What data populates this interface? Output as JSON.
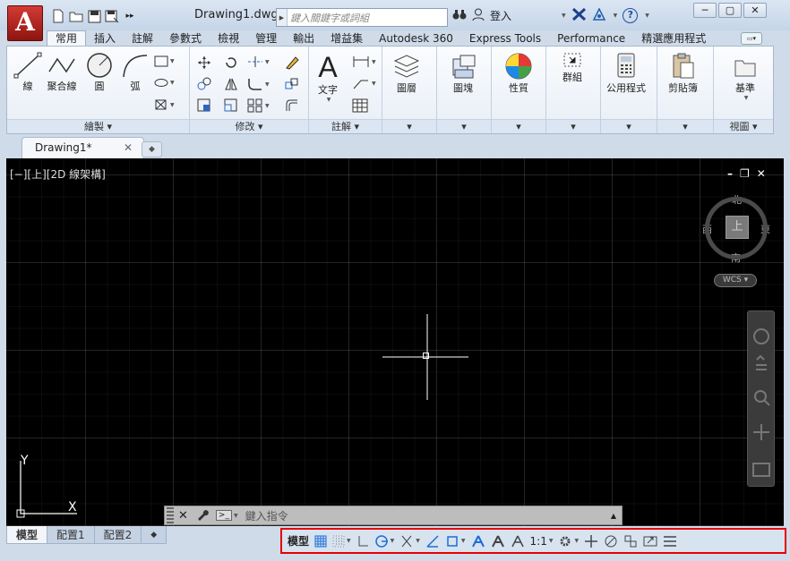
{
  "app": {
    "logo_letter": "A",
    "document_title": "Drawing1.dwg"
  },
  "search": {
    "placeholder": "鍵入關鍵字或詞組"
  },
  "title_tools": {
    "signin_label": "登入",
    "help_label": "?"
  },
  "window_controls": {
    "minimize": "─",
    "restore": "▢",
    "close": "✕"
  },
  "ribbon_tabs": [
    "常用",
    "插入",
    "註解",
    "參數式",
    "檢視",
    "管理",
    "輸出",
    "增益集",
    "Autodesk 360",
    "Express Tools",
    "Performance",
    "精選應用程式"
  ],
  "panels": {
    "draw": {
      "title": "繪製 ▾",
      "tools": [
        "線",
        "聚合線",
        "圓",
        "弧"
      ]
    },
    "modify": {
      "title": "修改 ▾"
    },
    "annotation": {
      "title": "註解 ▾",
      "text": "文字"
    },
    "layers": {
      "label": "圖層"
    },
    "block": {
      "label": "圖塊"
    },
    "properties": {
      "label": "性質"
    },
    "groups": {
      "label": "群組"
    },
    "utilities": {
      "label": "公用程式"
    },
    "clipboard": {
      "label": "剪貼簿"
    },
    "view": {
      "label": "基準",
      "title": "視圖 ▾"
    }
  },
  "doc_tab": {
    "label": "Drawing1*",
    "close": "✕"
  },
  "viewport": {
    "label": "[−][上][2D 線架構]",
    "controls": [
      "–",
      "❐",
      "✕"
    ]
  },
  "viewcube": {
    "top": "上",
    "north": "北",
    "south": "南",
    "east": "東",
    "west": "西",
    "wcs": "WCS"
  },
  "ucs": {
    "y": "Y",
    "x": "X"
  },
  "command": {
    "placeholder": "鍵入指令"
  },
  "layout_tabs": [
    "模型",
    "配置1",
    "配置2"
  ],
  "status": {
    "model_label": "模型",
    "scale": "1:1"
  },
  "colors": {
    "accent": "#1a6ed6",
    "highlight_border": "#e60000",
    "canvas": "#000000"
  }
}
